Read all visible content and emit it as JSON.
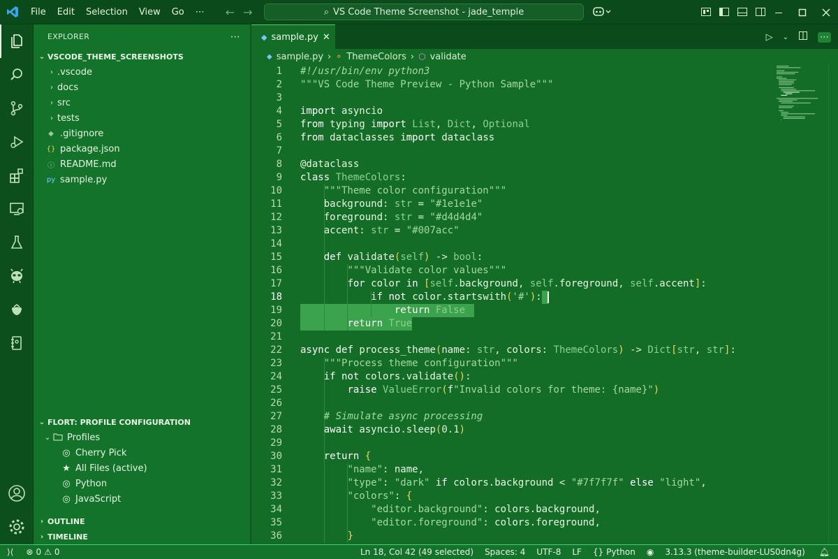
{
  "window": {
    "title": "VS Code Theme Screenshot - jade_temple",
    "menu": [
      "File",
      "Edit",
      "Selection",
      "View",
      "Go",
      "⋯"
    ]
  },
  "activity_bar": [
    "files-icon",
    "search-icon",
    "source-control-icon",
    "run-debug-icon",
    "extensions-icon",
    "remote-explorer-icon",
    "testing-icon",
    "alien-icon",
    "strawberry-icon",
    "notebook-icon",
    "account-icon",
    "settings-gear-icon"
  ],
  "sidebar": {
    "title": "EXPLORER",
    "workspace": "VSCODE_THEME_SCREENSHOTS",
    "items": [
      {
        "label": ".vscode",
        "type": "folder"
      },
      {
        "label": "docs",
        "type": "folder"
      },
      {
        "label": "src",
        "type": "folder"
      },
      {
        "label": "tests",
        "type": "folder"
      },
      {
        "label": ".gitignore",
        "type": "file",
        "icon": "◆"
      },
      {
        "label": "package.json",
        "type": "file",
        "icon": "{}"
      },
      {
        "label": "README.md",
        "type": "file",
        "icon": "ⓘ"
      },
      {
        "label": "sample.py",
        "type": "file",
        "icon": "py"
      }
    ],
    "profiles_section": "FLORT: PROFILE CONFIGURATION",
    "profiles_folder": "Profiles",
    "profiles": [
      {
        "label": "Cherry Pick",
        "icon": "person"
      },
      {
        "label": "All Files (active)",
        "icon": "star"
      },
      {
        "label": "Python",
        "icon": "person"
      },
      {
        "label": "JavaScript",
        "icon": "person"
      }
    ],
    "outline": "OUTLINE",
    "timeline": "TIMELINE"
  },
  "editor": {
    "tab": "sample.py",
    "breadcrumb": [
      "sample.py",
      "ThemeColors",
      "validate"
    ],
    "current_line": 18,
    "lines": [
      "#!/usr/bin/env python3",
      "\"\"\"VS Code Theme Preview - Python Sample\"\"\"",
      "",
      "import asyncio",
      "from typing import List, Dict, Optional",
      "from dataclasses import dataclass",
      "",
      "@dataclass",
      "class ThemeColors:",
      "    \"\"\"Theme color configuration\"\"\"",
      "    background: str = \"#1e1e1e\"",
      "    foreground: str = \"#d4d4d4\"",
      "    accent: str = \"#007acc\"",
      "",
      "    def validate(self) -> bool:",
      "        \"\"\"Validate color values\"\"\"",
      "        for color in [self.background, self.foreground, self.accent]:",
      "            if not color.startswith('#'):",
      "                return False",
      "        return True",
      "",
      "async def process_theme(name: str, colors: ThemeColors) -> Dict[str, str]:",
      "    \"\"\"Process theme configuration\"\"\"",
      "    if not colors.validate():",
      "        raise ValueError(f\"Invalid colors for theme: {name}\")",
      "",
      "    # Simulate async processing",
      "    await asyncio.sleep(0.1)",
      "",
      "    return {",
      "        \"name\": name,",
      "        \"type\": \"dark\" if colors.background < \"#7f7f7f\" else \"light\",",
      "        \"colors\": {",
      "            \"editor.background\": colors.background,",
      "            \"editor.foreground\": colors.foreground,",
      "        }"
    ]
  },
  "statusbar": {
    "errors": "0",
    "warnings": "0",
    "position": "Ln 18, Col 42 (49 selected)",
    "spaces": "Spaces: 4",
    "encoding": "UTF-8",
    "eol": "LF",
    "language": "Python",
    "interpreter": "3.13.3 (theme-builder-LUS0dn4g)"
  },
  "colors": {
    "accent": "#3ed07a",
    "editor_bg": "#136d27",
    "sidebar_bg": "#14732a",
    "selection": "#3aa34c"
  }
}
